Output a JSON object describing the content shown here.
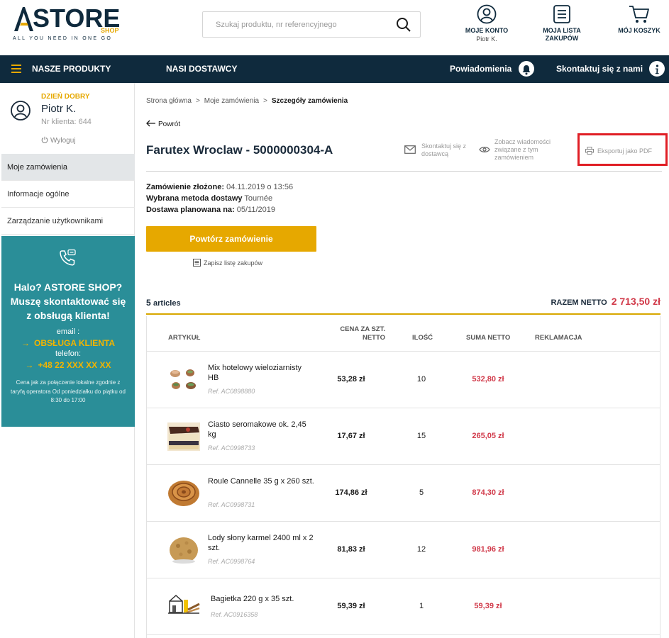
{
  "header": {
    "logo_text": "STORE",
    "logo_letter": "A",
    "logo_shop": "SHOP",
    "logo_tagline": "ALL YOU NEED IN ONE GO",
    "search_placeholder": "Szukaj produktu, nr referencyjnego",
    "account_label": "MOJE KONTO",
    "account_user": "Piotr K.",
    "list_label": "MOJA LISTA ZAKUPÓW",
    "cart_label": "MÓJ KOSZYK"
  },
  "nav": {
    "products": "NASZE PRODUKTY",
    "suppliers": "NASI DOSTAWCY",
    "notifications": "Powiadomienia",
    "contact": "Skontaktuj się z nami"
  },
  "sidebar": {
    "greeting": "DZIEŃ DOBRY",
    "user_name": "Piotr K.",
    "client_number": "Nr klienta: 644",
    "logout": "Wyloguj",
    "menu": [
      {
        "label": "Moje zamówienia"
      },
      {
        "label": "Informacje ogólne"
      },
      {
        "label": "Zarządzanie użytkownikami"
      }
    ],
    "call": {
      "question": "Halo? ASTORE SHOP? Muszę skontaktować się z obsługą klienta!",
      "email_label": "email :",
      "email_value": "OBSŁUGA KLIENTA",
      "phone_label": "telefon:",
      "phone_value": "+48 22 XXX XX XX",
      "note": "Cena jak za połączenie lokalne zgodnie z taryfą operatora Od poniedziałku do piątku od 8:30 do 17:00"
    }
  },
  "breadcrumb": {
    "home": "Strona główna",
    "orders": "Moje zamówienia",
    "current": "Szczegóły zamówienia"
  },
  "order": {
    "back": "Powrót",
    "title": "Farutex Wroclaw - 5000000304-A",
    "contact_supplier": "Skontaktuj się z dostawcą",
    "view_messages": "Zobacz wiadomości związane z tym zamówieniem",
    "export_pdf": "Eksportuj jako PDF",
    "placed_label": "Zamówienie złożone:",
    "placed_value": "04.11.2019 o 13:56",
    "delivery_method_label": "Wybrana metoda dostawy",
    "delivery_method_value": "Tournée",
    "delivery_planned_label": "Dostawa planowana na:",
    "delivery_planned_value": "05/11/2019",
    "repeat_button": "Powtórz zamówienie",
    "save_list": "Zapisz listę zakupów",
    "articles_count": "5",
    "articles_word": "articles",
    "total_label": "RAZEM NETTO",
    "total_value": "2 713,50 zł"
  },
  "table": {
    "headers": {
      "article": "ARTYKUŁ",
      "unit_price": "CENA ZA SZT. NETTO",
      "qty": "ILOŚĆ",
      "sum": "SUMA NETTO",
      "complaint": "REKLAMACJA"
    },
    "rows": [
      {
        "name": "Mix hotelowy wieloziarnisty HB",
        "ref": "Ref. AC0898880",
        "price": "53,28 zł",
        "qty": "10",
        "sum": "532,80 zł"
      },
      {
        "name": "Ciasto seromakowe ok. 2,45 kg",
        "ref": "Ref. AC0998733",
        "price": "17,67 zł",
        "qty": "15",
        "sum": "265,05 zł"
      },
      {
        "name": "Roule Cannelle 35 g x 260 szt.",
        "ref": "Ref. AC0998731",
        "price": "174,86 zł",
        "qty": "5",
        "sum": "874,30 zł"
      },
      {
        "name": "Lody słony karmel 2400 ml x 2 szt.",
        "ref": "Ref. AC0998764",
        "price": "81,83 zł",
        "qty": "12",
        "sum": "981,96 zł"
      },
      {
        "name": "Bagietka 220 g x 35 szt.",
        "ref": "Ref. AC0916358",
        "price": "59,39 zł",
        "qty": "1",
        "sum": "59,39 zł"
      }
    ]
  },
  "colors": {
    "navy": "#0f2a3d",
    "gold": "#e6a800",
    "teal": "#2a8e98",
    "price_red": "#d13a4a",
    "highlight_red": "#e01e25"
  }
}
